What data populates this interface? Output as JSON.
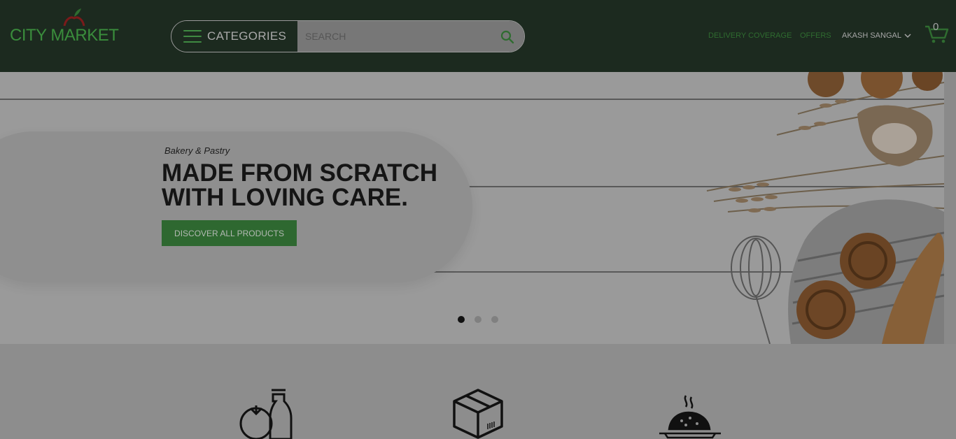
{
  "brand": {
    "name": "CITY MARKET"
  },
  "header": {
    "categories_label": "CATEGORIES",
    "search_placeholder": "SEARCH",
    "nav": {
      "delivery": "DELIVERY COVERAGE",
      "offers": "OFFERS",
      "user": "AKASH SANGAL"
    },
    "cart_count": "0"
  },
  "hero": {
    "subtitle": "Bakery & Pastry",
    "title_line1": "MADE FROM SCRATCH",
    "title_line2": "WITH LOVING CARE.",
    "cta": "DISCOVER ALL PRODUCTS",
    "slides": 3,
    "active_slide": 1
  },
  "features": {
    "icons": [
      "groceries-icon",
      "package-box-icon",
      "hot-dish-icon"
    ]
  },
  "colors": {
    "header_bg": "#1c2a1f",
    "accent_green": "#2e6830",
    "overlay_gray": "#8d8d8d"
  }
}
